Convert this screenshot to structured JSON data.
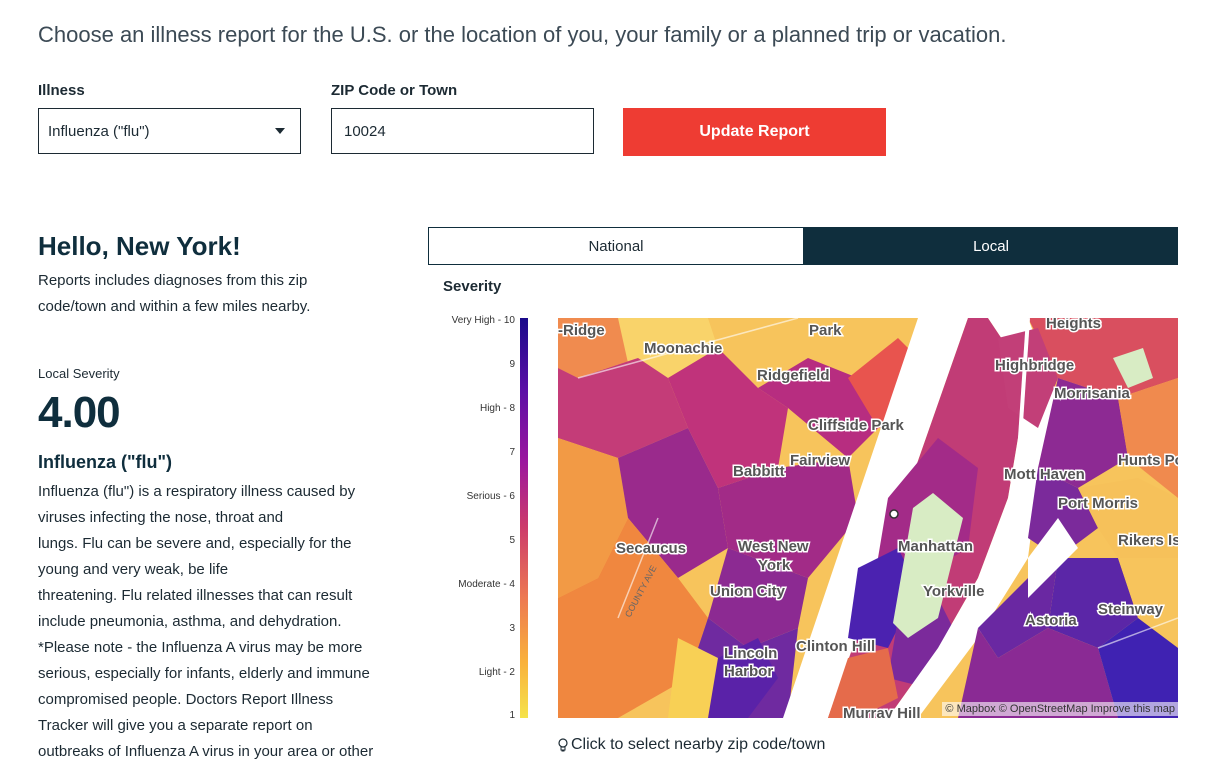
{
  "intro": "Choose an illness report for the U.S. or the location of you, your family or a planned trip or vacation.",
  "form": {
    "illness_label": "Illness",
    "illness_value": "Influenza (\"flu\")",
    "zip_label": "ZIP Code or Town",
    "zip_value": "10024",
    "update_label": "Update Report"
  },
  "report": {
    "greeting": "Hello, New York!",
    "description": "Reports includes diagnoses from this zip code/town and within a few miles nearby.",
    "severity_label": "Local Severity",
    "severity_value": "4.00",
    "illness_title": "Influenza (\"flu\")",
    "illness_lines": [
      "Influenza (flu\") is a respiratory illness caused by",
      "viruses infecting the nose, throat and",
      "lungs. Flu can be severe and, especially for the",
      "young and very weak, be life",
      "threatening. Flu related illnesses that can result",
      "include pneumonia, asthma, and dehydration.",
      "*Please note - the Influenza A virus may be more",
      "serious, especially for infants, elderly and immune",
      "compromised people. Doctors Report Illness",
      "Tracker will give you a separate report on",
      "outbreaks of Influenza A virus in your area or other"
    ]
  },
  "tabs": {
    "national": "National",
    "local": "Local"
  },
  "severity": {
    "title": "Severity",
    "scale": [
      "Very High - 10",
      "9",
      "High - 8",
      "7",
      "Serious - 6",
      "5",
      "Moderate - 4",
      "3",
      "Light - 2",
      "1"
    ]
  },
  "map": {
    "labels": [
      "-Ridge",
      "Park",
      "Moonachie",
      "Ridgefield",
      "Highbridge",
      "Morrisania",
      "Cliffside Park",
      "Fairview",
      "Babbitt",
      "Mott Haven",
      "Hunts Po",
      "Port Morris",
      "Secaucus",
      "West New",
      "York",
      "Manhattan",
      "Rikers Isl",
      "Union City",
      "Yorkville",
      "Steinway",
      "Astoria",
      "Lincoln",
      "Harbor",
      "Clinton Hill",
      "Murray Hill",
      "COUNTY AVE",
      "Heights"
    ],
    "attribution": "© Mapbox © OpenStreetMap Improve this map",
    "hint": "Click to select nearby zip code/town"
  }
}
